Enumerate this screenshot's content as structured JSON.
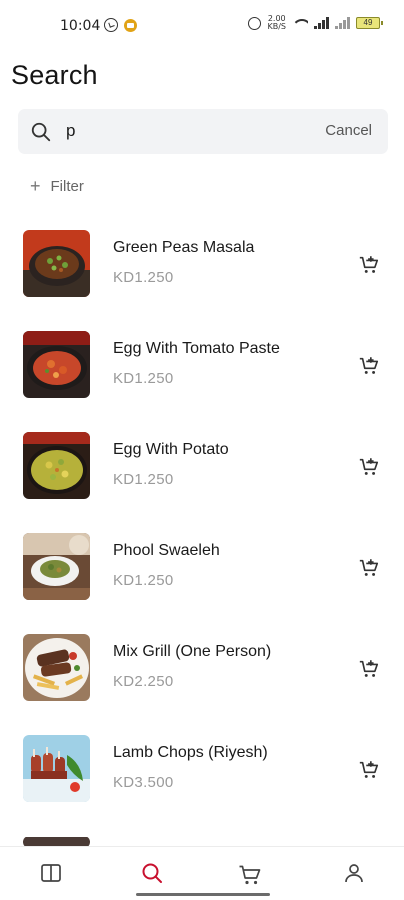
{
  "status_bar": {
    "time": "10:04",
    "speed_value": "2.00",
    "speed_unit": "KB/S",
    "battery": "49"
  },
  "page": {
    "title": "Search"
  },
  "search": {
    "value": "p",
    "cancel_label": "Cancel"
  },
  "filter": {
    "label": "Filter"
  },
  "products": [
    {
      "name": "Green Peas Masala",
      "price": "KD1.250"
    },
    {
      "name": "Egg With Tomato Paste",
      "price": "KD1.250"
    },
    {
      "name": "Egg With Potato",
      "price": "KD1.250"
    },
    {
      "name": "Phool Swaeleh",
      "price": "KD1.250"
    },
    {
      "name": "Mix Grill (One Person)",
      "price": "KD2.250"
    },
    {
      "name": "Lamb Chops (Riyesh)",
      "price": "KD3.500"
    }
  ],
  "bottom_nav": {
    "items": [
      {
        "icon": "menu-book-icon",
        "active": false
      },
      {
        "icon": "search-icon",
        "active": true
      },
      {
        "icon": "cart-icon",
        "active": false
      },
      {
        "icon": "profile-icon",
        "active": false
      }
    ],
    "active_color": "#c8102e",
    "inactive_color": "#444444"
  }
}
